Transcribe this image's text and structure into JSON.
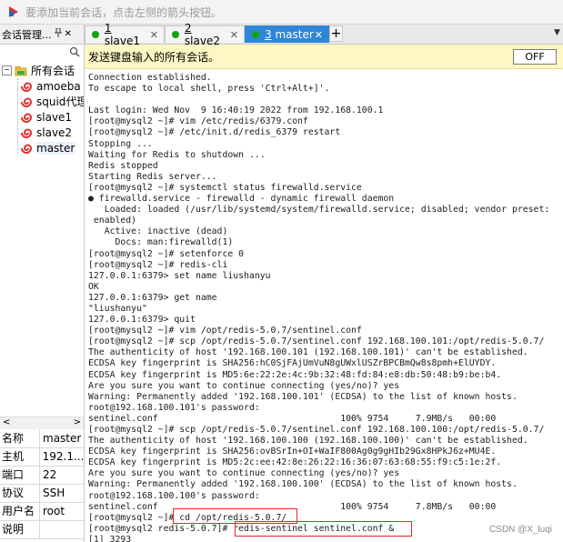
{
  "hint_bar": {
    "text": "要添加当前会话，点击左侧的箭头按钮。"
  },
  "left_panel": {
    "title": "会话管理...",
    "pin_glyph": "📌",
    "close_glyph": "✕",
    "tree": {
      "root_label": "所有会话",
      "root_toggle": "−",
      "items": [
        "amoeba",
        "squid代理",
        "slave1",
        "slave2",
        "master"
      ]
    },
    "properties": [
      {
        "key": "名称",
        "value": "master"
      },
      {
        "key": "主机",
        "value": "192.1..."
      },
      {
        "key": "端口",
        "value": "22"
      },
      {
        "key": "协议",
        "value": "SSH"
      },
      {
        "key": "用户名",
        "value": "root"
      },
      {
        "key": "说明",
        "value": ""
      }
    ]
  },
  "tabs": [
    {
      "number": "1",
      "label": " slave1",
      "close": "✕"
    },
    {
      "number": "2",
      "label": " slave2",
      "close": "✕"
    },
    {
      "number": "3",
      "label": " master",
      "close": "✕"
    }
  ],
  "tab_add_label": "+",
  "tab_menu_glyph": "▼",
  "broadcast": {
    "text": "发送键盘输入的所有会话。",
    "toggle": "OFF"
  },
  "terminal": {
    "lines": [
      "Connection established.",
      "To escape to local shell, press 'Ctrl+Alt+]'.",
      "",
      "Last login: Wed Nov  9 16:40:19 2022 from 192.168.100.1",
      "[root@mysql2 ~]# vim /etc/redis/6379.conf",
      "[root@mysql2 ~]# /etc/init.d/redis_6379 restart",
      "Stopping ...",
      "Waiting for Redis to shutdown ...",
      "Redis stopped",
      "Starting Redis server...",
      "[root@mysql2 ~]# systemctl status firewalld.service",
      "● firewalld.service - firewalld - dynamic firewall daemon",
      "   Loaded: loaded (/usr/lib/systemd/system/firewalld.service; disabled; vendor preset:",
      " enabled)",
      "   Active: inactive (dead)",
      "     Docs: man:firewalld(1)",
      "[root@mysql2 ~]# setenforce 0",
      "[root@mysql2 ~]# redis-cli",
      "127.0.0.1:6379> set name liushanyu",
      "OK",
      "127.0.0.1:6379> get name",
      "\"liushanyu\"",
      "127.0.0.1:6379> quit",
      "[root@mysql2 ~]# vim /opt/redis-5.0.7/sentinel.conf",
      "[root@mysql2 ~]# scp /opt/redis-5.0.7/sentinel.conf 192.168.100.101:/opt/redis-5.0.7/",
      "The authenticity of host '192.168.100.101 (192.168.100.101)' can't be established.",
      "ECDSA key fingerprint is SHA256:hC0SjFAjUmVuN8gUWxlUSZrBPCBmQw8s8pmh+ElUYDY.",
      "ECDSA key fingerprint is MD5:6e:22:2e:4c:9b:32:48:fd:84:e8:db:50:48:b9:be:b4.",
      "Are you sure you want to continue connecting (yes/no)? yes",
      "Warning: Permanently added '192.168.100.101' (ECDSA) to the list of known hosts.",
      "root@192.168.100.101's password:",
      "sentinel.conf                                  100% 9754     7.9MB/s   00:00",
      "[root@mysql2 ~]# scp /opt/redis-5.0.7/sentinel.conf 192.168.100.100:/opt/redis-5.0.7/",
      "The authenticity of host '192.168.100.100 (192.168.100.100)' can't be established.",
      "ECDSA key fingerprint is SHA256:ovBSrIn+OI+WaIF800Ag0g9gHIb29Gx8HPkJ6z+MU4E.",
      "ECDSA key fingerprint is MD5:2c:ee:42:8e:26:22:16:36:07:63:68:55:f9:c5:1e:2f.",
      "Are you sure you want to continue connecting (yes/no)? yes",
      "Warning: Permanently added '192.168.100.100' (ECDSA) to the list of known hosts.",
      "root@192.168.100.100's password:",
      "sentinel.conf                                  100% 9754     7.8MB/s   00:00",
      "[root@mysql2 ~]# cd /opt/redis-5.0.7/",
      "[root@mysql2 redis-5.0.7]# redis-sentinel sentinel.conf &",
      "[1] 3293"
    ]
  },
  "watermark": "CSDN @X_luqi"
}
